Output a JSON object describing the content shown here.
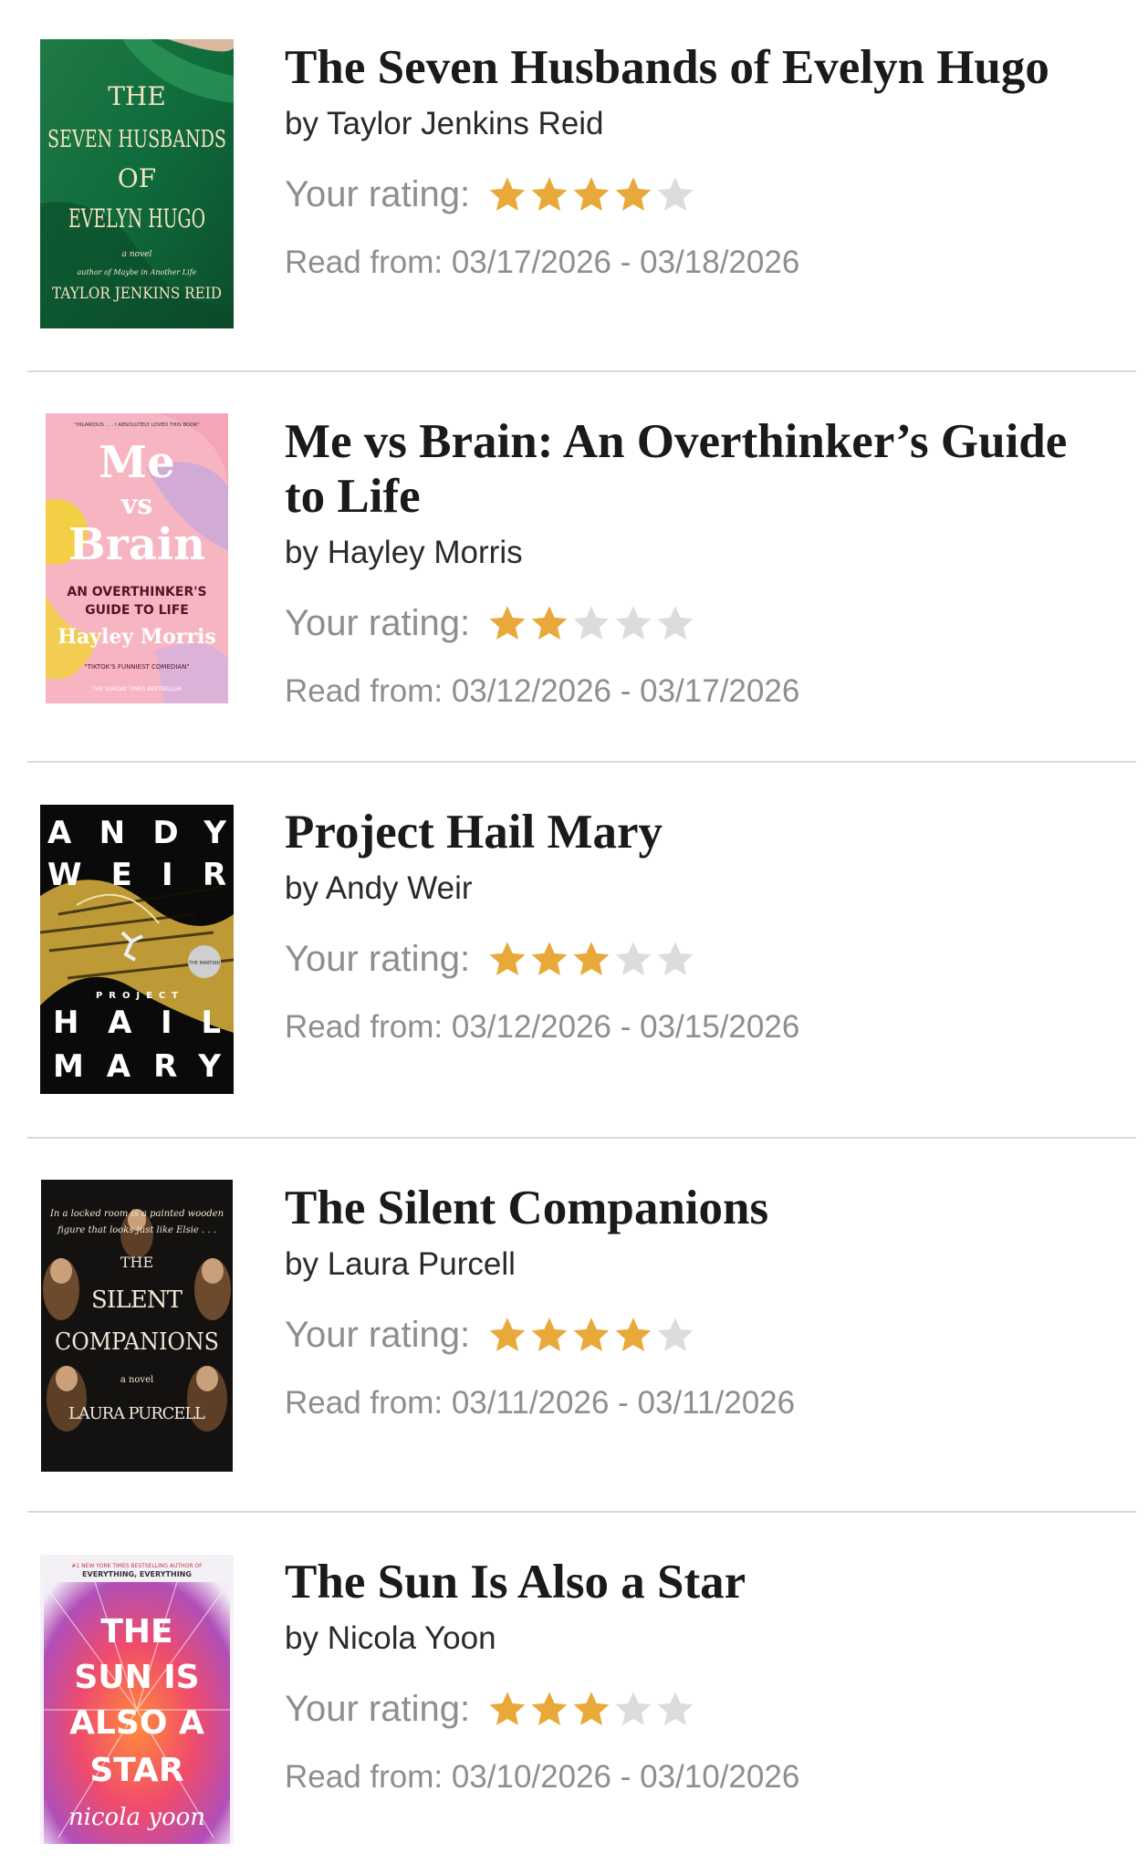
{
  "rating_label": "Your rating:",
  "colors": {
    "star_on": "#E9A93A",
    "star_off": "#DCDCDC"
  },
  "books": [
    {
      "title": "The Seven Husbands of Evelyn Hugo",
      "author": "by Taylor Jenkins Reid",
      "rating": 4,
      "dates": "Read from: 03/17/2026 - 03/18/2026",
      "cover": {
        "line1": "THE",
        "line2": "SEVEN HUSBANDS",
        "line3": "OF",
        "line4": "EVELYN HUGO",
        "line5": "a novel",
        "line6": "author of Maybe in Another Life",
        "line7": "TAYLOR JENKINS REID"
      }
    },
    {
      "title": "Me vs Brain: An Overthinker’s Guide to Life",
      "author": "by Hayley Morris",
      "rating": 2,
      "dates": "Read from: 03/12/2026 - 03/17/2026",
      "cover": {
        "quote": "\"HILARIOUS . . . I ABSOLUTELY LOVED THIS BOOK\"",
        "line1": "Me",
        "line2": "vs",
        "line3": "Brain",
        "line4": "AN OVERTHINKER'S",
        "line5": "GUIDE TO LIFE",
        "line6": "Hayley Morris",
        "line7": "\"TIKTOK'S FUNNIEST COMEDIAN\"",
        "line8": "THE SUNDAY TIMES BESTSELLER"
      }
    },
    {
      "title": "Project Hail Mary",
      "author": "by Andy Weir",
      "rating": 3,
      "dates": "Read from: 03/12/2026 - 03/15/2026",
      "cover": {
        "line1": "ANDY",
        "line2": "WEIR",
        "line3": "PROJECT",
        "line4": "HAIL",
        "line5": "MARY",
        "badge": "THE MARTIAN"
      }
    },
    {
      "title": "The Silent Companions",
      "author": "by Laura Purcell",
      "rating": 4,
      "dates": "Read from: 03/11/2026 - 03/11/2026",
      "cover": {
        "tag1": "In a locked room is a painted wooden",
        "tag2": "figure that looks just like Elsie . . .",
        "line1": "THE",
        "line2": "SILENT",
        "line3": "COMPANIONS",
        "line4": "a novel",
        "line5": "LAURA PURCELL"
      }
    },
    {
      "title": "The Sun Is Also a Star",
      "author": "by Nicola Yoon",
      "rating": 3,
      "dates": "Read from: 03/10/2026 - 03/10/2026",
      "cover": {
        "tag1": "#1 NEW YORK TIMES BESTSELLING AUTHOR OF",
        "tag2": "EVERYTHING, EVERYTHING",
        "line1": "THE",
        "line2": "SUN IS",
        "line3": "ALSO A",
        "line4": "STAR",
        "line5": "nicola yoon"
      }
    }
  ]
}
